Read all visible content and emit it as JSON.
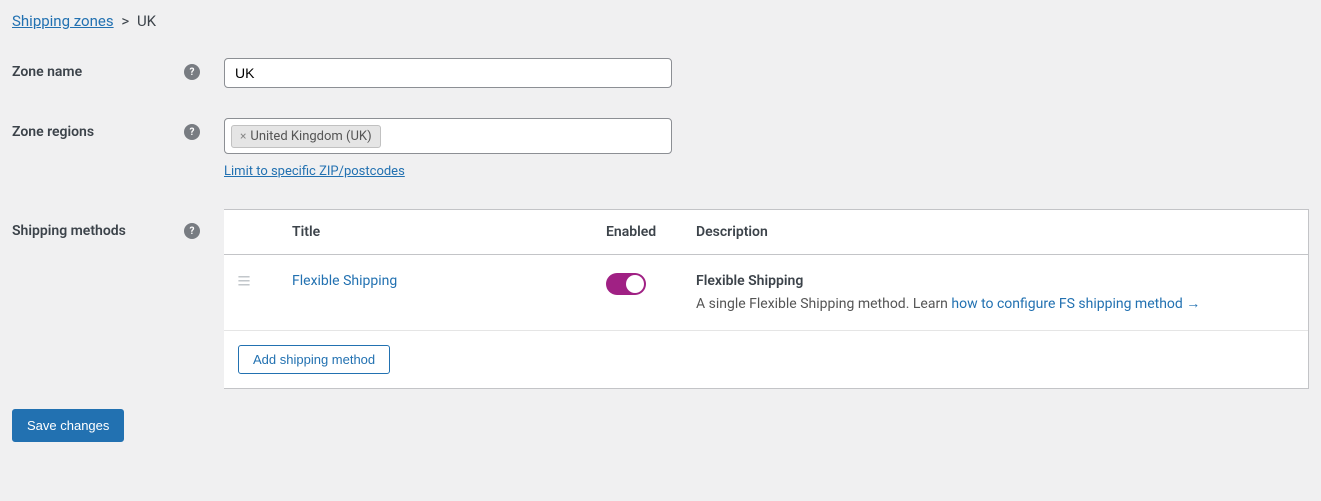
{
  "breadcrumb": {
    "parent": "Shipping zones",
    "separator": ">",
    "current": "UK"
  },
  "labels": {
    "zone_name": "Zone name",
    "zone_regions": "Zone regions",
    "shipping_methods": "Shipping methods",
    "limit_link": "Limit to specific ZIP/postcodes",
    "add_method": "Add shipping method",
    "save": "Save changes"
  },
  "form": {
    "zone_name_value": "UK",
    "region_tag": "United Kingdom (UK)"
  },
  "table": {
    "headers": {
      "title": "Title",
      "enabled": "Enabled",
      "description": "Description"
    },
    "rows": [
      {
        "title": "Flexible Shipping",
        "enabled": true,
        "desc_title": "Flexible Shipping",
        "desc_text": "A single Flexible Shipping method. Learn ",
        "desc_link_text": "how to configure FS shipping method →"
      }
    ]
  }
}
